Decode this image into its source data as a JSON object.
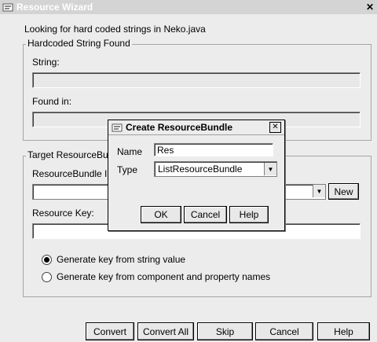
{
  "window": {
    "title": "Resource Wizard",
    "close_glyph": "✕",
    "icon": "app-icon"
  },
  "main": {
    "looking_text": "Looking for hard coded strings in Neko.java",
    "group_found": {
      "title": "Hardcoded String Found",
      "string_label": "String:",
      "string_value": "",
      "found_in_label": "Found in:",
      "found_in_value": ""
    },
    "group_target": {
      "title": "Target ResourceBu",
      "bundle_label": "ResourceBundle I",
      "bundle_value": "",
      "new_button": "New",
      "key_label": "Resource Key:",
      "key_value": "",
      "radio_string": "Generate key from string value",
      "radio_component": "Generate key from component and property names",
      "selected_radio": "radio_string"
    },
    "buttons": {
      "convert": "Convert",
      "convert_all": "Convert All",
      "skip": "Skip",
      "cancel": "Cancel",
      "help": "Help"
    }
  },
  "dialog": {
    "title": "Create ResourceBundle",
    "close_glyph": "✕",
    "name_label": "Name",
    "name_value": "Res",
    "type_label": "Type",
    "type_value": "ListResourceBundle",
    "ok_button": "OK",
    "cancel_button": "Cancel",
    "help_button": "Help"
  },
  "colors": {
    "window_bg": "#ececec",
    "title_bg": "#d4d4d4",
    "title_text": "#ffffff",
    "field_disabled": "#e8e8e8",
    "field_enabled": "#ffffff"
  }
}
